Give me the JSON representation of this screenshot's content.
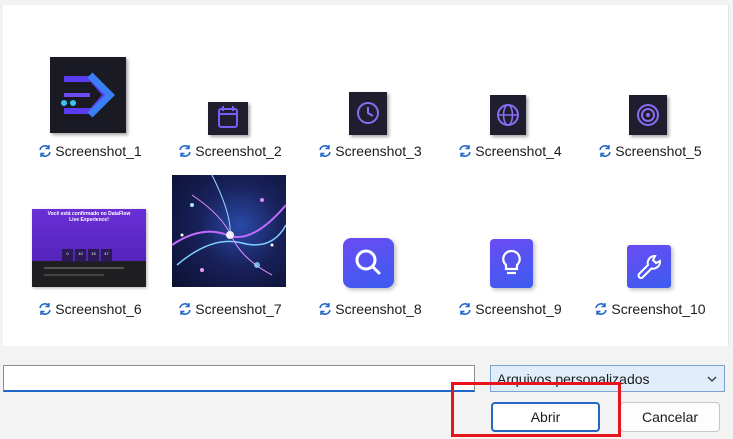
{
  "files": [
    {
      "name": "Screenshot_1",
      "thumb": "dataflow-logo"
    },
    {
      "name": "Screenshot_2",
      "thumb": "calendar-icon"
    },
    {
      "name": "Screenshot_3",
      "thumb": "clock-icon"
    },
    {
      "name": "Screenshot_4",
      "thumb": "globe-icon"
    },
    {
      "name": "Screenshot_5",
      "thumb": "target-icon"
    },
    {
      "name": "Screenshot_6",
      "thumb": "webpage-preview"
    },
    {
      "name": "Screenshot_7",
      "thumb": "abstract-network-image"
    },
    {
      "name": "Screenshot_8",
      "thumb": "search-icon"
    },
    {
      "name": "Screenshot_9",
      "thumb": "lightbulb-icon"
    },
    {
      "name": "Screenshot_10",
      "thumb": "wrench-icon"
    }
  ],
  "webpage_preview": {
    "headline": "Você está confirmado no DataFlow Live Experience!",
    "countdown": [
      "0",
      "10",
      "15",
      "47"
    ]
  },
  "file_name_input": {
    "value": ""
  },
  "file_type_filter": {
    "selected": "Arquivos personalizados"
  },
  "buttons": {
    "open": "Abrir",
    "cancel": "Cancelar"
  },
  "colors": {
    "accent": "#2466c4",
    "highlight": "#e8141c",
    "sync": "#1e66c8"
  }
}
